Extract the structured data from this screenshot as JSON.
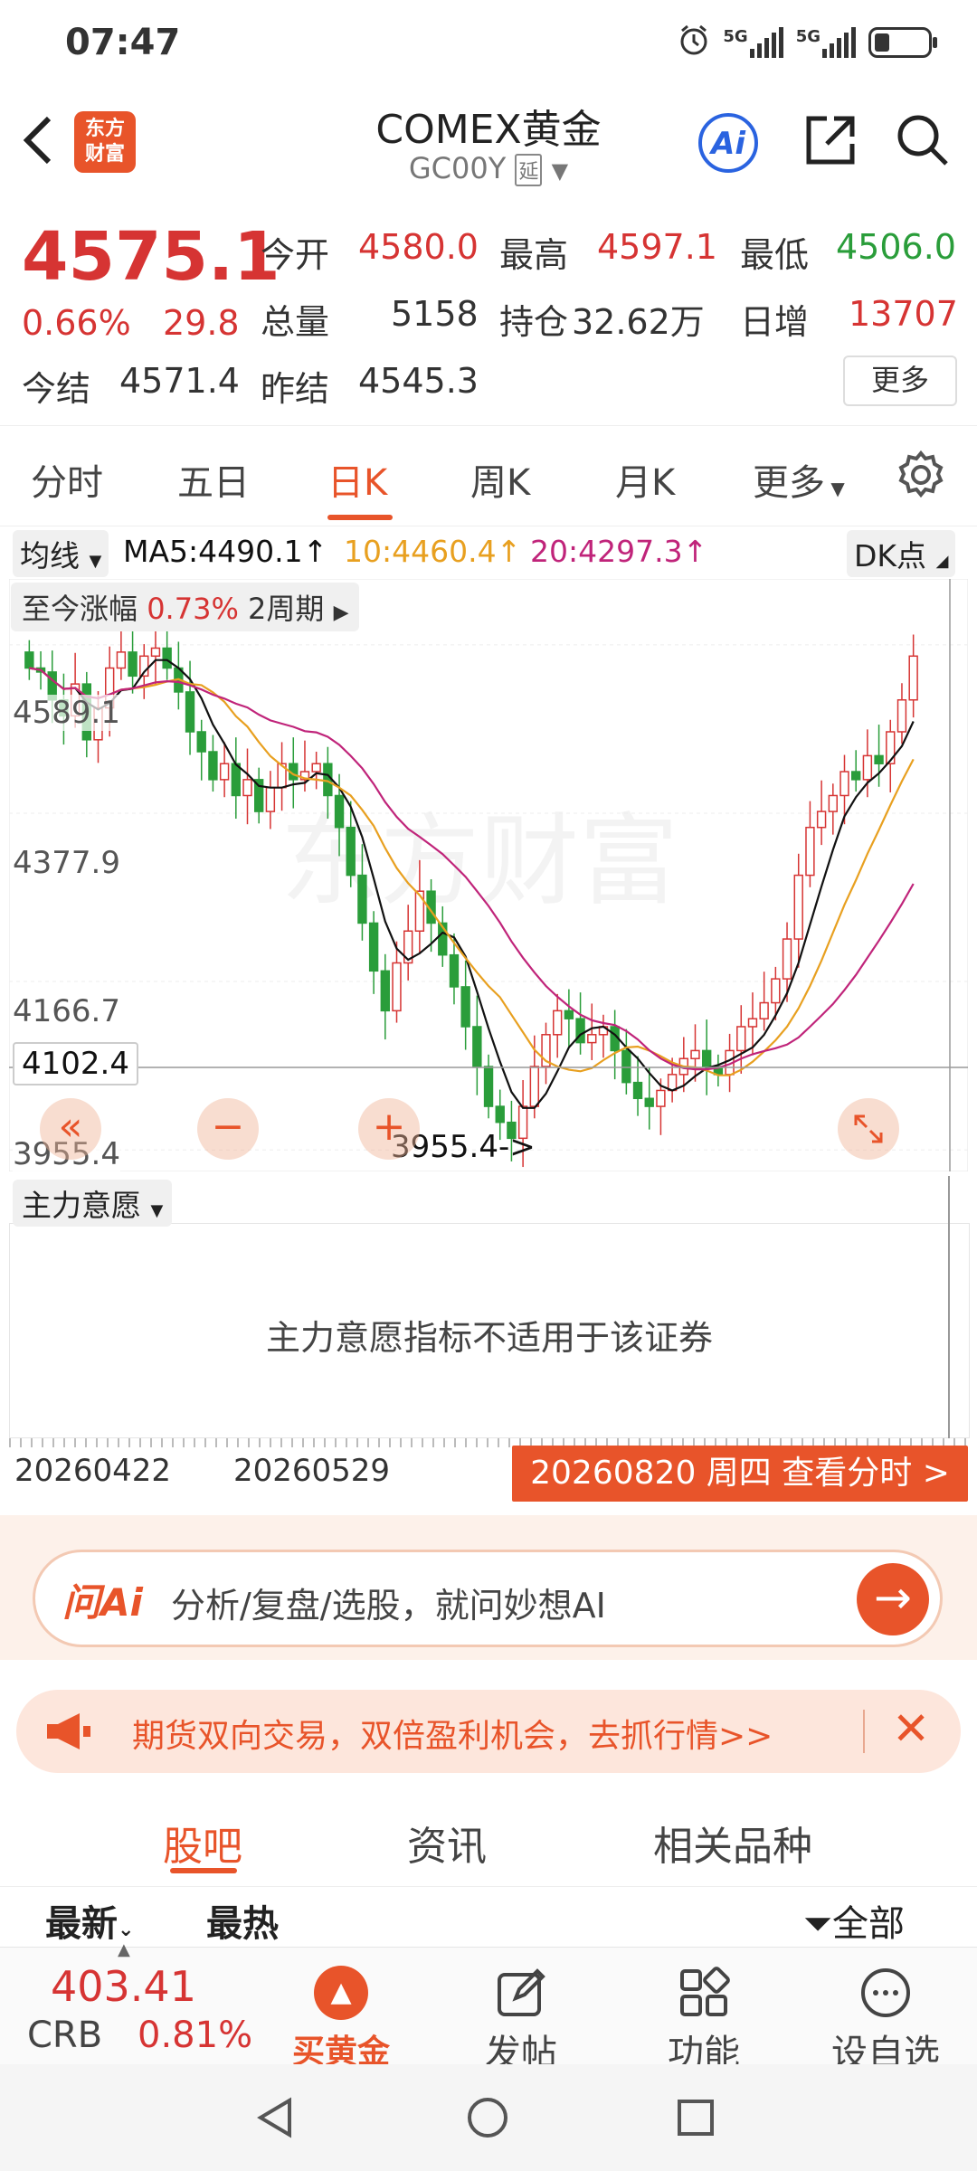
{
  "status_bar": {
    "time": "07:47",
    "net1": "5G",
    "net2": "5G"
  },
  "header": {
    "logo_line1": "东方",
    "logo_line2": "财富",
    "title": "COMEX黄金",
    "code": "GC00Y",
    "delay_tag": "延",
    "ai_label": "Ai"
  },
  "quote": {
    "price": "4575.1",
    "change_pct": "0.66%",
    "change": "29.8",
    "open_label": "今开",
    "open": "4580.0",
    "high_label": "最高",
    "high": "4597.1",
    "low_label": "最低",
    "low": "4506.0",
    "volume_label": "总量",
    "volume": "5158",
    "oi_label": "持仓",
    "oi": "32.62万",
    "daily_inc_label": "日增",
    "daily_inc": "13707",
    "settle_label": "今结",
    "settle": "4571.4",
    "prev_settle_label": "昨结",
    "prev_settle": "4545.3",
    "more_label": "更多"
  },
  "ktabs": [
    "分时",
    "五日",
    "日K",
    "周K",
    "月K",
    "更多"
  ],
  "ma": {
    "dropdown": "均线",
    "ma5": "MA5:4490.1↑",
    "ma10": "10:4460.4↑",
    "ma20": "20:4297.3↑",
    "dk": "DK点"
  },
  "chart": {
    "stat_label": "至今涨幅",
    "stat_value": "0.73%",
    "stat_period": "2周期",
    "y_top": "4589.1",
    "y2": "4377.9",
    "y3": "4166.7",
    "y_bottom": "3955.4",
    "crosshair_price": "4102.4",
    "low_marker": "3955.4->",
    "watermark": "东方财富"
  },
  "chart_data": {
    "type": "candlestick",
    "title": "COMEX黄金 日K",
    "ylim": [
      3955.4,
      4589.1
    ],
    "yticks": [
      4589.1,
      4377.9,
      4166.7,
      3955.4
    ],
    "series": [
      {
        "name": "MA5",
        "last": 4490.1,
        "color": "#111111"
      },
      {
        "name": "MA10",
        "last": 4460.4,
        "color": "#e8a020"
      },
      {
        "name": "MA20",
        "last": 4297.3,
        "color": "#c0247a"
      }
    ],
    "close_values": [
      4560,
      4555,
      4520,
      4500,
      4540,
      4470,
      4510,
      4560,
      4580,
      4550,
      4575,
      4585,
      4560,
      4530,
      4480,
      4455,
      4420,
      4440,
      4400,
      4420,
      4380,
      4410,
      4440,
      4420,
      4430,
      4440,
      4400,
      4360,
      4300,
      4240,
      4180,
      4130,
      4190,
      4230,
      4280,
      4240,
      4200,
      4160,
      4110,
      4060,
      4010,
      3990,
      3970,
      4010,
      4060,
      4100,
      4130,
      4120,
      4090,
      4100,
      4110,
      4080,
      4040,
      4020,
      4010,
      4030,
      4050,
      4070,
      4080,
      4060,
      4050,
      4080,
      4110,
      4120,
      4140,
      4170,
      4220,
      4300,
      4360,
      4380,
      4400,
      4430,
      4420,
      4450,
      4440,
      4480,
      4520,
      4575
    ]
  },
  "indicator": {
    "dropdown": "主力意愿",
    "message": "主力意愿指标不适用于该证券"
  },
  "dates": {
    "d1": "20260422",
    "d2": "20260529",
    "button": "20260820 周四 查看分时 >"
  },
  "ask_ai": {
    "logo": "问Ai",
    "placeholder": "分析/复盘/选股，就问妙想AI"
  },
  "promo": {
    "text": "期货双向交易，双倍盈利机会，去抓行情>>"
  },
  "section_tabs": [
    "股吧",
    "资讯",
    "相关品种"
  ],
  "filters": {
    "latest": "最新",
    "hot": "最热",
    "all": "全部"
  },
  "bottom_bar": {
    "index_value": "403.41",
    "index_name": "CRB",
    "index_pct": "0.81%",
    "buy_gold": "买黄金",
    "post": "发帖",
    "function": "功能",
    "watch": "设自选"
  },
  "colors": {
    "accent": "#e8542a",
    "up": "#d63433",
    "down": "#2a9d3a"
  }
}
